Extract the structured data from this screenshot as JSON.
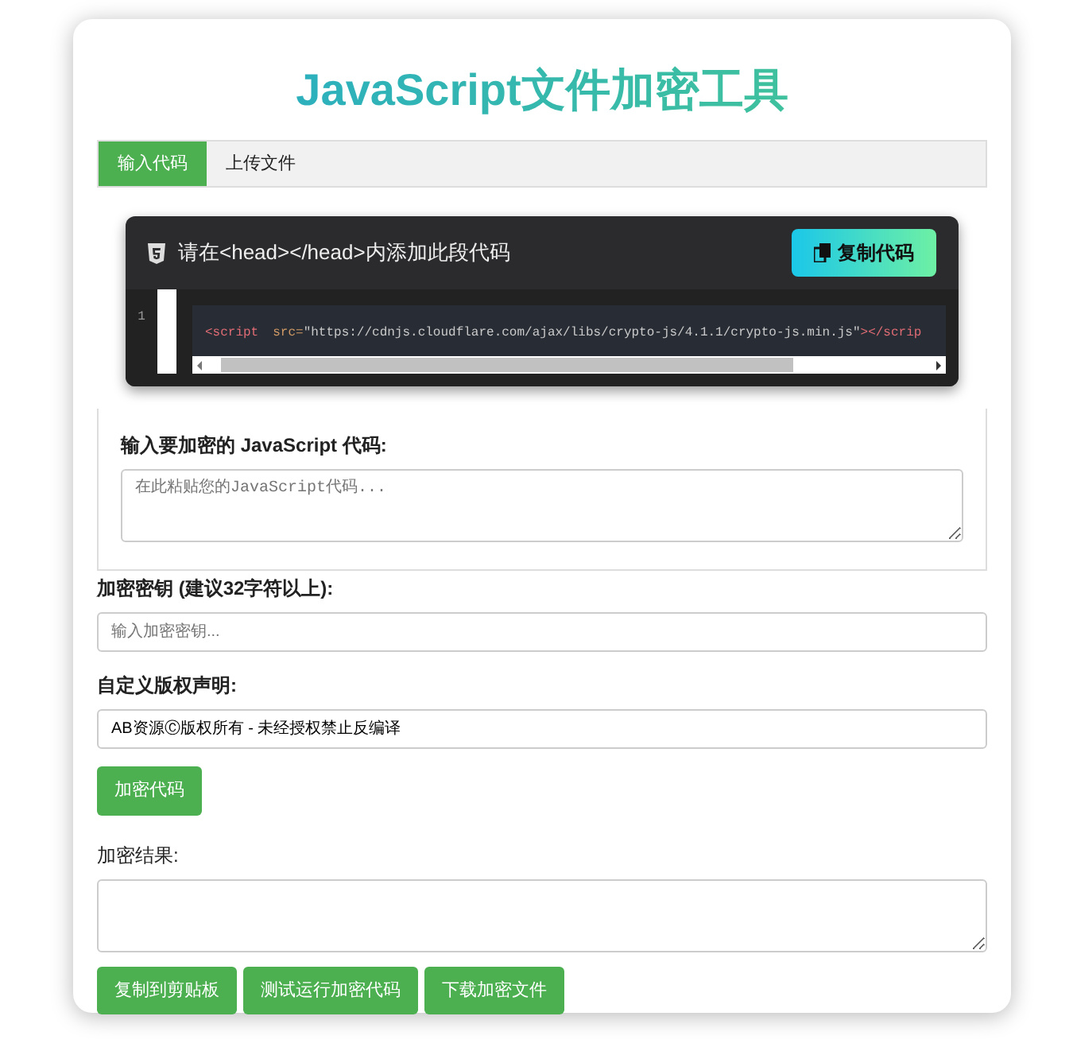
{
  "title": "JavaScript文件加密工具",
  "tabs": [
    {
      "label": "输入代码",
      "selected": true
    },
    {
      "label": "上传文件",
      "selected": false
    }
  ],
  "snippet": {
    "heading": "请在<head></head>内添加此段代码",
    "copy_button": "复制代码",
    "line_number": "1",
    "tokens": [
      {
        "kind": "tag",
        "text": "<script"
      },
      {
        "kind": "attr",
        "text": "src="
      },
      {
        "kind": "string",
        "text": "\"https://cdnjs.cloudflare.com/ajax/libs/crypto-js/4.1.1/crypto-js.min.js\""
      },
      {
        "kind": "tag",
        "text": "></scrip"
      }
    ]
  },
  "code_input": {
    "label": "输入要加密的 JavaScript 代码:",
    "placeholder": "在此粘贴您的JavaScript代码..."
  },
  "key_input": {
    "label": "加密密钥 (建议32字符以上):",
    "placeholder": "输入加密密钥..."
  },
  "copyright_input": {
    "label": "自定义版权声明:",
    "value": "AB资源Ⓒ版权所有 - 未经授权禁止反编译"
  },
  "encrypt_button": "加密代码",
  "result": {
    "label": "加密结果:"
  },
  "actions": [
    "复制到剪贴板",
    "测试运行加密代码",
    "下载加密文件"
  ]
}
